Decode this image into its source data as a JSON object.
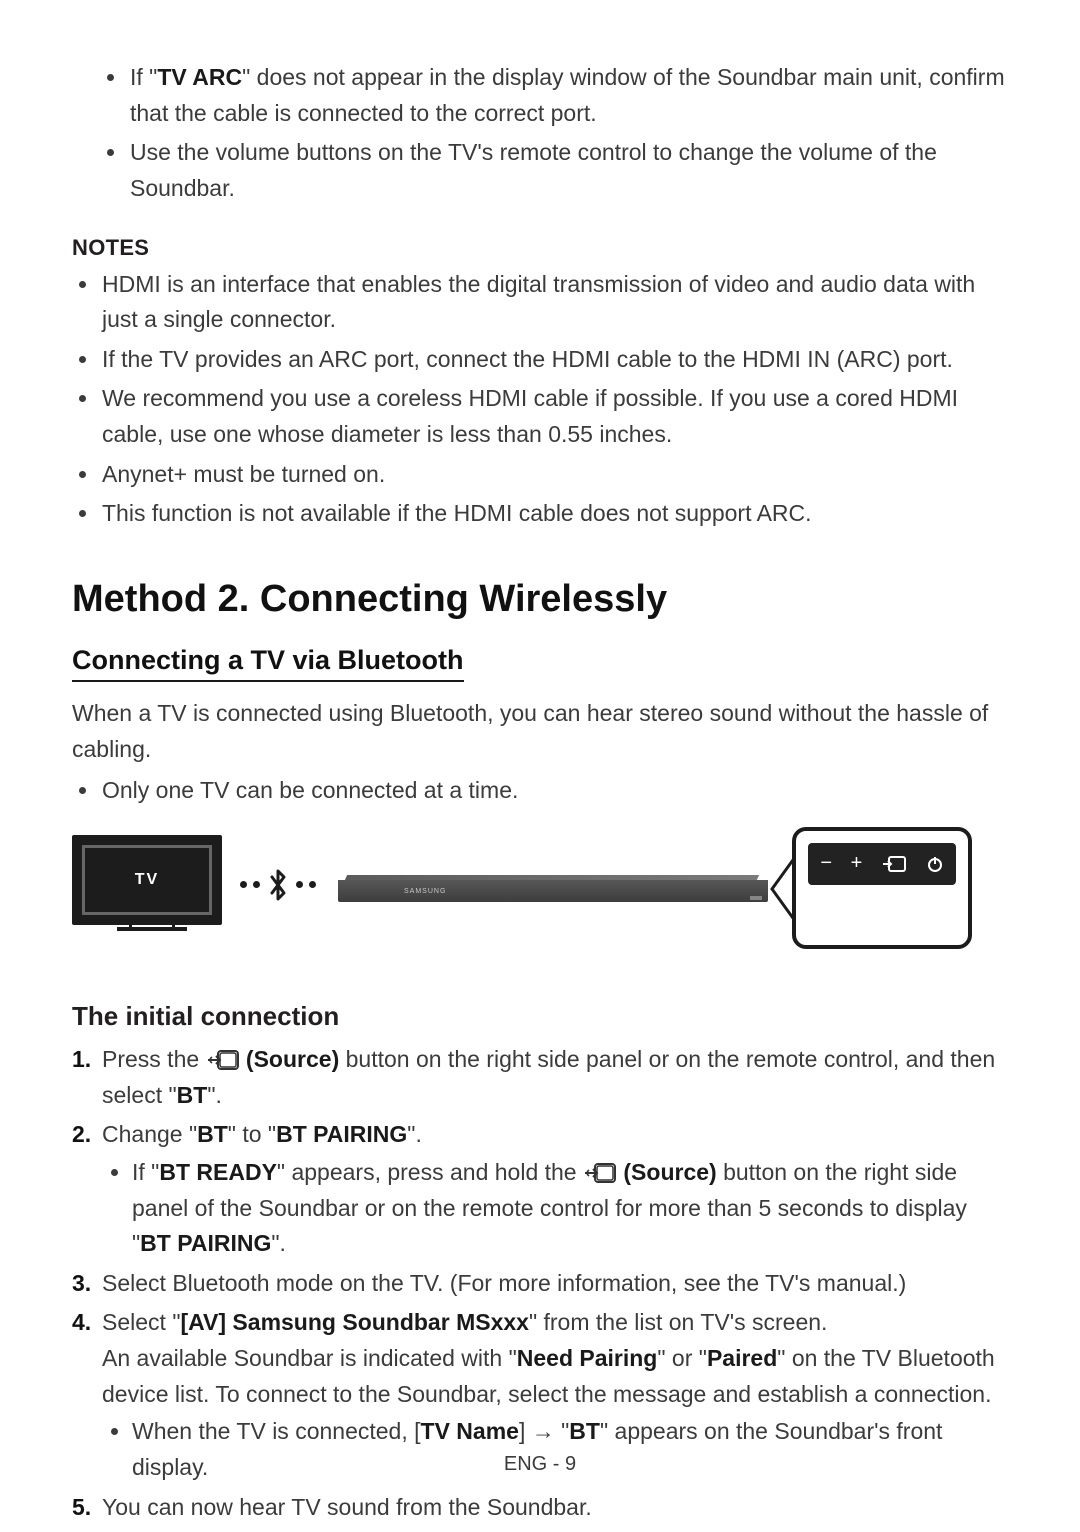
{
  "top_bullets": {
    "tv_arc_pre": "If \"",
    "tv_arc_bold": "TV ARC",
    "tv_arc_post": "\" does not appear in the display window of the Soundbar main unit, confirm that the cable is connected to the correct port.",
    "volume": "Use the volume buttons on the TV's remote control to change the volume of the Soundbar."
  },
  "notes_heading": "NOTES",
  "notes": [
    "HDMI is an interface that enables the digital transmission of video and audio data with just a single connector.",
    "If the TV provides an ARC port, connect the HDMI cable to the HDMI IN (ARC) port.",
    "We recommend you use a coreless HDMI cable if possible. If you use a cored HDMI cable, use one whose diameter is less than 0.55 inches.",
    "Anynet+ must be turned on.",
    "This function is not available if the HDMI cable does not support ARC."
  ],
  "method_title": "Method 2. Connecting Wirelessly",
  "bt_heading": "Connecting a TV via Bluetooth",
  "bt_intro": "When a TV is connected using Bluetooth, you can hear stereo sound without the hassle of cabling.",
  "bt_bullet": "Only one TV can be connected at a time.",
  "tv_label": "TV",
  "panel": {
    "minus": "−",
    "plus": "+"
  },
  "initial_heading": "The initial connection",
  "step1": {
    "pre": "Press the ",
    "source_bold": " (Source)",
    "post": " button on the right side panel or on the remote control, and then select \"",
    "bt": "BT",
    "post2": "\"."
  },
  "step2": {
    "pre": "Change \"",
    "bt": "BT",
    "mid": "\" to \"",
    "pairing": "BT PAIRING",
    "post": "\".",
    "sub_pre": "If \"",
    "ready": "BT READY",
    "sub_mid": "\" appears, press and hold the ",
    "source_bold": " (Source)",
    "sub_mid2": " button on the right side panel of the Soundbar or on the remote control for more than 5 seconds to display \"",
    "sub_pairing": "BT PAIRING",
    "sub_post": "\"."
  },
  "step3": "Select Bluetooth mode on the TV. (For more information, see the TV's manual.)",
  "step4": {
    "pre": "Select \"",
    "av": "[AV] Samsung Soundbar MSxxx",
    "post": "\" from the list on TV's screen.",
    "line2_pre": "An available Soundbar is indicated with \"",
    "need": "Need Pairing",
    "line2_mid": "\" or \"",
    "paired": "Paired",
    "line2_post": "\" on the TV Bluetooth device list. To connect to the Soundbar, select the message and establish a connection.",
    "sub_pre": "When the TV is connected, [",
    "tvname": "TV Name",
    "sub_mid": "] → \"",
    "bt": "BT",
    "sub_post": "\" appears on the Soundbar's front display."
  },
  "step5": "You can now hear TV sound from the Soundbar.",
  "footer": "ENG - 9"
}
